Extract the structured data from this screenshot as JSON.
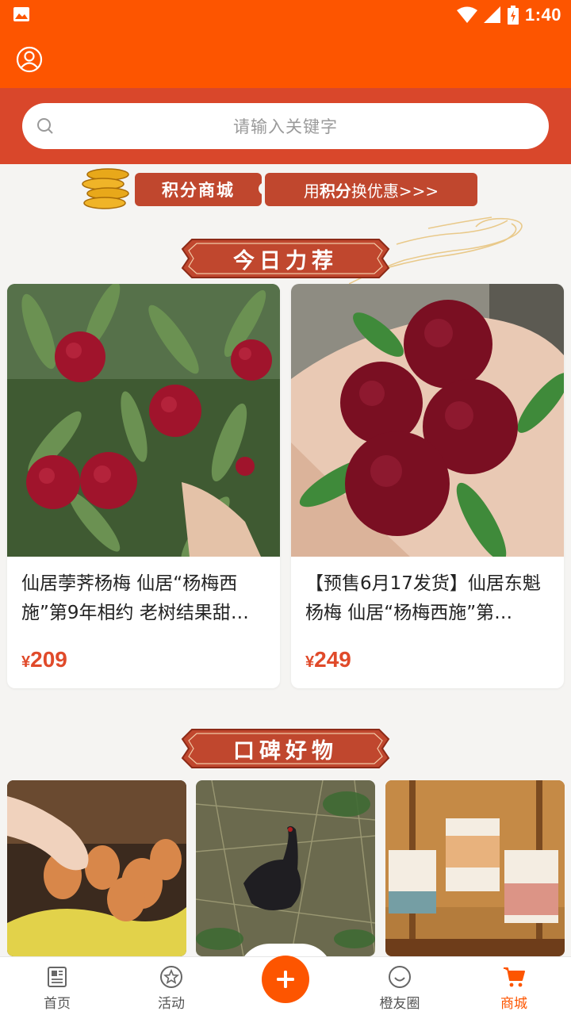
{
  "status_bar": {
    "time": "1:40"
  },
  "search": {
    "placeholder": "请输入关键字"
  },
  "points": {
    "tag": "积分商城",
    "link_prefix": "用",
    "link_bold": "积分",
    "link_suffix": "换优惠>>>"
  },
  "sections": {
    "today": "今日力荐",
    "praise": "口碑好物"
  },
  "products": [
    {
      "name": "仙居荸荠杨梅 仙居“杨梅西施”第9年相约 老树结果甜…",
      "currency": "¥",
      "price": "209"
    },
    {
      "name": "【预售6月17发货】仙居东魁杨梅 仙居“杨梅西施”第…",
      "currency": "¥",
      "price": "249"
    }
  ],
  "tabs": [
    {
      "label": "首页",
      "icon": "newspaper-icon",
      "active": false
    },
    {
      "label": "活动",
      "icon": "star-circle-icon",
      "active": false
    },
    {
      "label": "橙友圈",
      "icon": "smile-icon",
      "active": false
    },
    {
      "label": "商城",
      "icon": "cart-icon",
      "active": true
    }
  ],
  "colors": {
    "brand": "#fd5500",
    "band": "#d9472b",
    "price": "#e04a2a",
    "ribbon": "#c0472e"
  }
}
